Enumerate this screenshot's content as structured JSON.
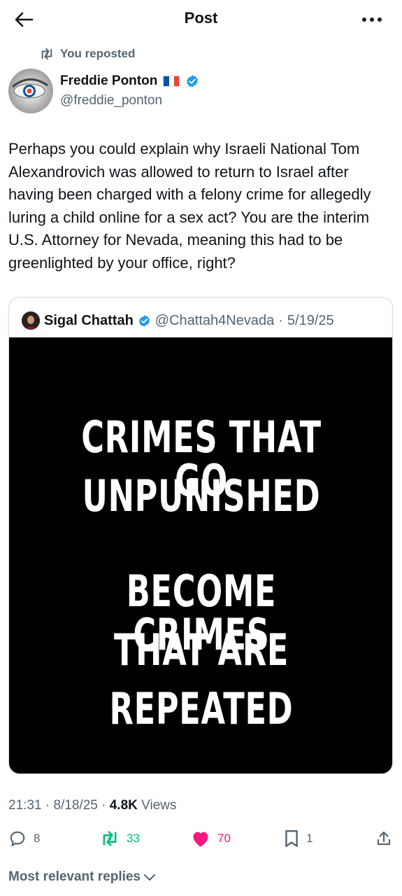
{
  "header": {
    "title": "Post",
    "back_icon": "back-arrow-icon",
    "more_icon": "more-horizontal-icon"
  },
  "repost": {
    "label": "You reposted",
    "icon": "repost-icon"
  },
  "author": {
    "name": "Freddie Ponton",
    "handle": "@freddie_ponton",
    "flag_colors": [
      "#0055A4",
      "#FFFFFF",
      "#EF4135"
    ],
    "verified_color": "#1D9BF0"
  },
  "post": {
    "text": "Perhaps you could explain why Israeli National Tom Alexandrovich was allowed to return to Israel after having been charged with a felony crime for allegedly luring a child online for a sex act? You are the interim U.S. Attorney for Nevada, meaning this had to be greenlighted by your office, right?"
  },
  "quote": {
    "name": "Sigal Chattah",
    "handle": "@Chattah4Nevada",
    "separator": "·",
    "date": "5/19/25",
    "image_lines": [
      "CRIMES THAT GO",
      "UNPUNISHED",
      "BECOME CRIMES",
      "THAT ARE",
      "REPEATED"
    ]
  },
  "meta": {
    "time": "21:31",
    "sep": "·",
    "date": "8/18/25",
    "views_count": "4.8K",
    "views_label": "Views"
  },
  "actions": {
    "replies": "8",
    "reposts": "33",
    "likes": "70",
    "bookmarks": "1",
    "repost_color": "#00BA7C",
    "like_color": "#F91880"
  },
  "footer": {
    "sort_label": "Most relevant replies"
  }
}
